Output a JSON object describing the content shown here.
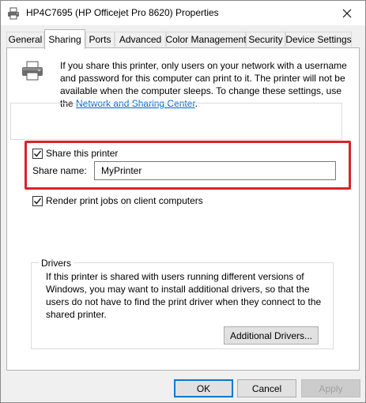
{
  "window": {
    "title": "HP4C7695 (HP Officejet Pro 8620) Properties"
  },
  "tabs": [
    {
      "label": "General"
    },
    {
      "label": "Sharing"
    },
    {
      "label": "Ports"
    },
    {
      "label": "Advanced"
    },
    {
      "label": "Color Management"
    },
    {
      "label": "Security"
    },
    {
      "label": "Device Settings"
    }
  ],
  "sharing": {
    "info_text": "If you share this printer, only users on your network with a username and password for this computer can print to it. The printer will not be available when the computer sleeps. To change these settings, use the ",
    "info_link": "Network and Sharing Center",
    "info_end": ".",
    "share_checkbox_label": "Share this printer",
    "share_checked": true,
    "share_name_label": "Share name:",
    "share_name_value": "MyPrinter",
    "render_checkbox_label": "Render print jobs on client computers",
    "render_checked": true
  },
  "drivers": {
    "legend": "Drivers",
    "text": "If this printer is shared with users running different versions of Windows, you may want to install additional drivers, so that the users do not have to find the print driver when they connect to the shared printer.",
    "button_label": "Additional Drivers..."
  },
  "footer": {
    "ok_label": "OK",
    "cancel_label": "Cancel",
    "apply_label": "Apply"
  },
  "colors": {
    "highlight": "#d8232a",
    "link": "#0066cc",
    "focus": "#0078d7"
  },
  "icons": {
    "title_icon": "printer-icon",
    "close_icon": "close-icon",
    "page_icon": "printer-icon",
    "check_icon": "check-icon"
  }
}
